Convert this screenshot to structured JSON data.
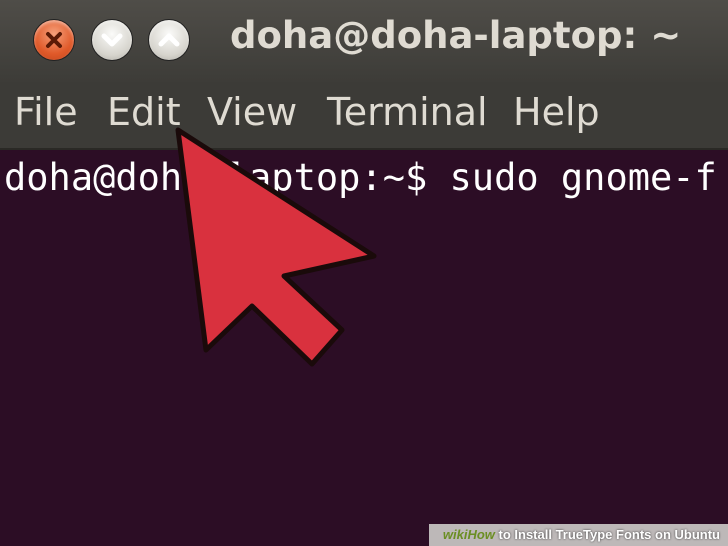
{
  "window": {
    "title": "doha@doha-laptop: ~",
    "buttons": {
      "close_icon": "close-icon",
      "minimize_icon": "chevron-down-icon",
      "maximize_icon": "chevron-up-icon"
    }
  },
  "menubar": {
    "items": [
      {
        "label": "File"
      },
      {
        "label": "Edit"
      },
      {
        "label": "View"
      },
      {
        "label": "Terminal"
      },
      {
        "label": "Help"
      }
    ]
  },
  "terminal": {
    "prompt_text": "doha@doha-laptop:~$ sudo gnome-f"
  },
  "overlay": {
    "pointer_icon": "arrow-pointer-icon",
    "pointer_color": "#d9313e"
  },
  "watermark": {
    "brand_wiki": "wiki",
    "brand_how": "How",
    "caption": " to Install TrueType Fonts on Ubuntu"
  },
  "colors": {
    "terminal_background": "#2c0d25",
    "titlebar": "#3c3b37",
    "text_light": "#dfdbd2",
    "close_button": "#e05a2a"
  }
}
